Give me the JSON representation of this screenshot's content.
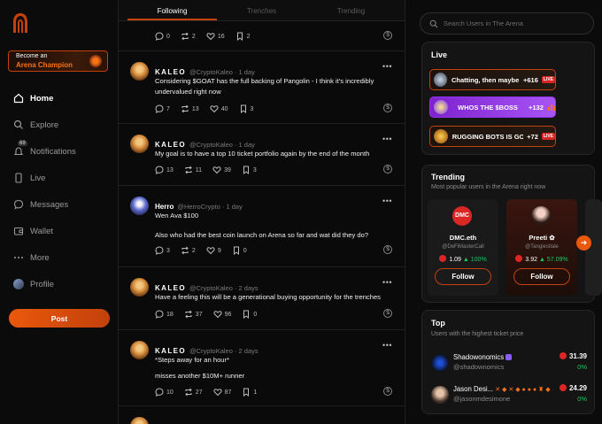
{
  "sidebar": {
    "promo_line1": "Become an",
    "promo_line2": "Arena Champion",
    "items": [
      {
        "label": "Home",
        "icon": "home-icon"
      },
      {
        "label": "Explore",
        "icon": "search-icon"
      },
      {
        "label": "Notifications",
        "icon": "bell-icon",
        "badge": "69"
      },
      {
        "label": "Live",
        "icon": "mobile-icon"
      },
      {
        "label": "Messages",
        "icon": "message-icon"
      },
      {
        "label": "Wallet",
        "icon": "wallet-icon"
      },
      {
        "label": "More",
        "icon": "more-icon"
      },
      {
        "label": "Profile",
        "icon": "avatar-icon"
      }
    ],
    "post_label": "Post"
  },
  "feed": {
    "tabs": [
      "Following",
      "Trenches",
      "Trending"
    ],
    "posts": [
      {
        "name": "",
        "handle": "",
        "time": "",
        "lines": [],
        "replies": "0",
        "reposts": "2",
        "likes": "16",
        "bookmarks": "2"
      },
      {
        "name": "KALEO",
        "handle": "@CryptoKaleo · 1 day",
        "lines": [
          "Considering $GOAT has the full backing of Pangolin - I think it's incredibly undervalued right now"
        ],
        "replies": "7",
        "reposts": "13",
        "likes": "40",
        "bookmarks": "3"
      },
      {
        "name": "KALEO",
        "handle": "@CryptoKaleo · 1 day",
        "lines": [
          "My goal is to have a top 10 ticket portfolio again by the end of the month"
        ],
        "replies": "13",
        "reposts": "11",
        "likes": "39",
        "bookmarks": "3"
      },
      {
        "name": "Herro",
        "handle": "@HerroCrypto · 1 day",
        "lines": [
          "Wen Ava $100",
          "Also who had the best coin launch on Arena so far and wat did they do?"
        ],
        "replies": "3",
        "reposts": "2",
        "likes": "9",
        "bookmarks": "0"
      },
      {
        "name": "KALEO",
        "handle": "@CryptoKaleo · 2 days",
        "lines": [
          "Have a feeling this will be a generational buying opportunity for the trenches"
        ],
        "replies": "18",
        "reposts": "37",
        "likes": "96",
        "bookmarks": "0"
      },
      {
        "name": "KALEO",
        "handle": "@CryptoKaleo · 2 days",
        "lines": [
          "*Steps away for an hour*",
          "misses another $10M+ runner"
        ],
        "replies": "10",
        "reposts": "27",
        "likes": "87",
        "bookmarks": "1"
      }
    ]
  },
  "right": {
    "search_placeholder": "Search Users in The Arena",
    "live": {
      "title": "Live",
      "items": [
        {
          "title": "Chatting, then maybe ...",
          "count": "+616",
          "badge": "LIVE"
        },
        {
          "title": "WHOS THE $BOSS",
          "count": "+132",
          "badge": ""
        },
        {
          "title": "RUGGING BOTS IS GO...",
          "count": "+72",
          "badge": "LIVE"
        }
      ]
    },
    "trending": {
      "title": "Trending",
      "subtitle": "Most popular users in the Arena right now",
      "avatar_text": "DMC",
      "cards": [
        {
          "name": "DMC.eth",
          "handle": "@DeFiMasterCall",
          "price": "1.09",
          "change": "100%",
          "follow": "Follow"
        },
        {
          "name": "Preeti ✿",
          "handle": "@Tangiestlale",
          "price": "3.92",
          "change": "57.09%",
          "follow": "Follow"
        }
      ]
    },
    "top": {
      "title": "Top",
      "subtitle": "Users with the highest ticket price",
      "rows": [
        {
          "name": "Shadowonomics",
          "handle": "@shadownomics",
          "price": "31.39",
          "change": "0%"
        },
        {
          "name": "Jason Desi...",
          "handle": "@jasonmdesimone",
          "price": "24.29",
          "change": "0%"
        }
      ]
    }
  }
}
